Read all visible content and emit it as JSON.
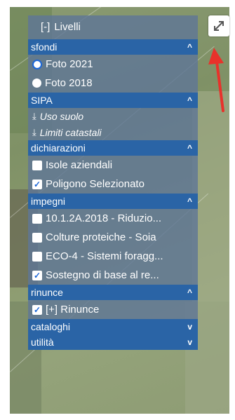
{
  "panel": {
    "title_toggle": "[-]",
    "title": "Livelli",
    "sections": [
      {
        "key": "sfondi",
        "label": "sfondi",
        "chevron": "^"
      },
      {
        "key": "sipa",
        "label": "SIPA",
        "chevron": "^"
      },
      {
        "key": "dichiarazioni",
        "label": "dichiarazioni",
        "chevron": "^"
      },
      {
        "key": "impegni",
        "label": "impegni",
        "chevron": "^"
      },
      {
        "key": "rinunce",
        "label": "rinunce",
        "chevron": "^"
      },
      {
        "key": "cataloghi",
        "label": "cataloghi",
        "chevron": "v"
      },
      {
        "key": "utilita",
        "label": "utilità",
        "chevron": "v"
      }
    ],
    "sfondi_items": [
      {
        "label": "Foto 2021",
        "selected": true
      },
      {
        "label": "Foto 2018",
        "selected": false
      }
    ],
    "sipa_items": [
      {
        "label": "Uso suolo"
      },
      {
        "label": "Limiti catastali"
      }
    ],
    "dichiarazioni_items": [
      {
        "label": "Isole aziendali",
        "checked": false
      },
      {
        "label": "Poligono Selezionato",
        "checked": true
      }
    ],
    "impegni_items": [
      {
        "label": "10.1.2A.2018 - Riduzio...",
        "checked": false
      },
      {
        "label": "Colture proteiche - Soia",
        "checked": false
      },
      {
        "label": "ECO-4 - Sistemi foragg...",
        "checked": false
      },
      {
        "label": "Sostegno di base al re...",
        "checked": true
      }
    ],
    "rinunce_items": [
      {
        "label": "[+] Rinunce",
        "checked": true
      }
    ]
  },
  "expand_button": {
    "icon": "expand-icon"
  },
  "annotation": {
    "arrow_color": "#e8322b"
  }
}
